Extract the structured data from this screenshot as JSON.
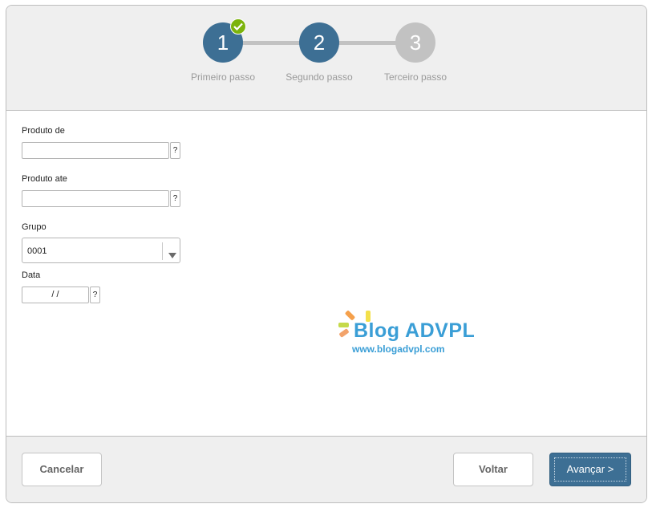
{
  "wizard": {
    "steps": [
      {
        "number": "1",
        "label": "Primeiro passo",
        "state": "completed"
      },
      {
        "number": "2",
        "label": "Segundo passo",
        "state": "current"
      },
      {
        "number": "3",
        "label": "Terceiro passo",
        "state": "pending"
      }
    ],
    "colors": {
      "active": "#3d6f94",
      "pending": "#c2c2c2",
      "check": "#7cb30c"
    }
  },
  "form": {
    "produto_de": {
      "label": "Produto de",
      "value": "",
      "help": "?"
    },
    "produto_ate": {
      "label": "Produto ate",
      "value": "",
      "help": "?"
    },
    "grupo": {
      "label": "Grupo",
      "value": "0001"
    },
    "data": {
      "label": "Data",
      "value": "  /  /",
      "help": "?"
    }
  },
  "watermark": {
    "title": "Blog ADVPL",
    "url": "www.blogadvpl.com"
  },
  "footer": {
    "cancel_label": "Cancelar",
    "back_label": "Voltar",
    "next_label": "Avançar >"
  }
}
